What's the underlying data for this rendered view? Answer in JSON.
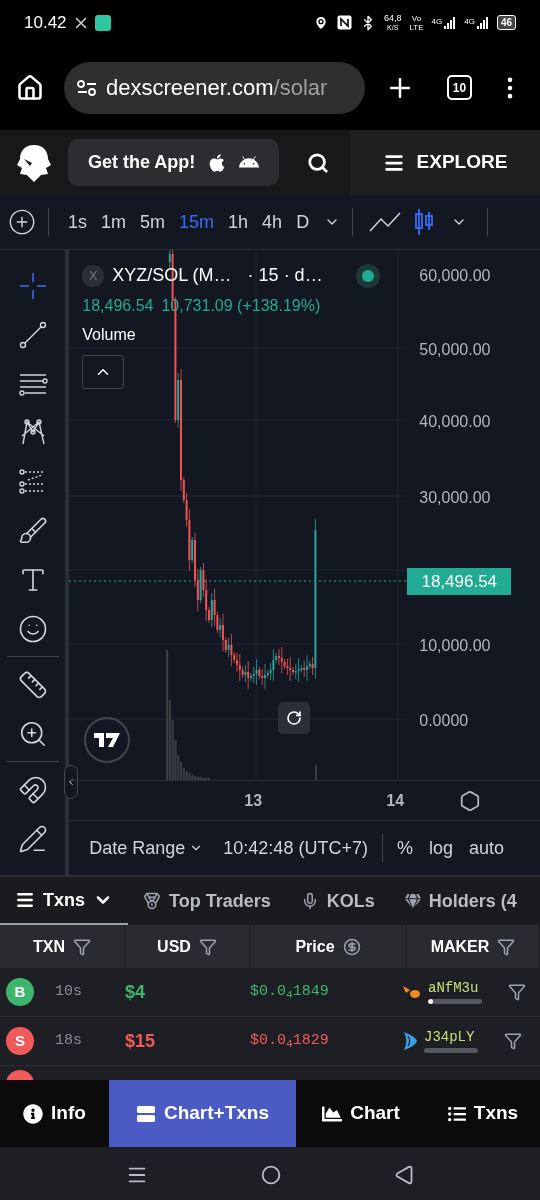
{
  "status_bar": {
    "time": "10.42",
    "speed": "64,8",
    "speed_unit": "K/S",
    "volte_top": "Vo",
    "volte_bottom": "LTE",
    "networks": [
      "4G",
      "4G"
    ],
    "battery": "46"
  },
  "browser": {
    "url_host": "dexscreener.com",
    "url_path": "/solar",
    "tab_count": "10"
  },
  "header": {
    "get_app": "Get the App!",
    "explore": "EXPLORE"
  },
  "timeframes": [
    {
      "label": "1s",
      "selected": false
    },
    {
      "label": "1m",
      "selected": false
    },
    {
      "label": "5m",
      "selected": false
    },
    {
      "label": "15m",
      "selected": true
    },
    {
      "label": "1h",
      "selected": false
    },
    {
      "label": "4h",
      "selected": false
    },
    {
      "label": "D",
      "selected": false
    }
  ],
  "chart_types": [
    {
      "kind": "line",
      "selected": false
    },
    {
      "kind": "candles",
      "selected": true
    }
  ],
  "tools": [
    {
      "kind": "crosshair",
      "selected": true
    },
    {
      "kind": "trend-line",
      "selected": false
    },
    {
      "kind": "fib",
      "selected": false
    },
    {
      "kind": "pattern",
      "selected": false
    },
    {
      "kind": "projection",
      "selected": false
    },
    {
      "kind": "brush",
      "selected": false
    },
    {
      "kind": "text",
      "selected": false
    },
    {
      "kind": "emoji",
      "selected": false
    },
    {
      "kind": "divider"
    },
    {
      "kind": "ruler",
      "selected": false
    },
    {
      "kind": "zoom",
      "selected": false
    },
    {
      "kind": "divider"
    },
    {
      "kind": "magnet",
      "selected": false
    },
    {
      "kind": "lock-drawing",
      "selected": false
    }
  ],
  "chart": {
    "close_label": "X",
    "pair": "XYZ/SOL (M…",
    "details": "· 15 · d…",
    "price": "18,496.54",
    "change": "10,731.09 (+138.19%)",
    "volume_label": "Volume",
    "y_labels": [
      "60,000.00",
      "50,000.00",
      "40,000.00",
      "30,000.00",
      "10,000.00",
      "0.0000"
    ],
    "price_tag": "18,496.54",
    "x_labels": [
      "13",
      "14"
    ],
    "date_range": "Date Range",
    "clock": "10:42:48 (UTC+7)",
    "scale_options": [
      "%",
      "log",
      "auto"
    ]
  },
  "txn_tabs": [
    {
      "label": "Txns",
      "selected": true,
      "kind": "list"
    },
    {
      "label": "Top Traders",
      "selected": false,
      "kind": "medal"
    },
    {
      "label": "KOLs",
      "selected": false,
      "kind": "mic"
    },
    {
      "label": "Holders (4",
      "selected": false,
      "kind": "gem"
    }
  ],
  "table": {
    "columns": [
      {
        "label": "TXN",
        "kind": "filter"
      },
      {
        "label": "USD",
        "kind": "filter"
      },
      {
        "label": "Price",
        "kind": "currency"
      },
      {
        "label": "MAKER",
        "kind": "filter"
      }
    ],
    "rows": [
      {
        "kind": "buy",
        "badge": "B",
        "age": "10s",
        "usd": "$4",
        "price": "$0.0$_{4}$1849",
        "maker": "aNfM3u",
        "maker_icon": {
          "kind": "shrimp"
        },
        "level": 0.1
      },
      {
        "kind": "sell",
        "badge": "S",
        "age": "18s",
        "usd": "$15",
        "price": "$0.0$_{4}$1829",
        "maker": "J34pLY",
        "maker_icon": {
          "kind": "fish"
        },
        "level": 0
      }
    ]
  },
  "bottom_nav": [
    {
      "label": "Info",
      "selected": false,
      "kind": "info"
    },
    {
      "label": "Chart+Txns",
      "selected": true,
      "kind": "split"
    },
    {
      "label": "Chart",
      "selected": false,
      "kind": "chart"
    },
    {
      "label": "Txns",
      "selected": false,
      "kind": "list"
    }
  ]
}
